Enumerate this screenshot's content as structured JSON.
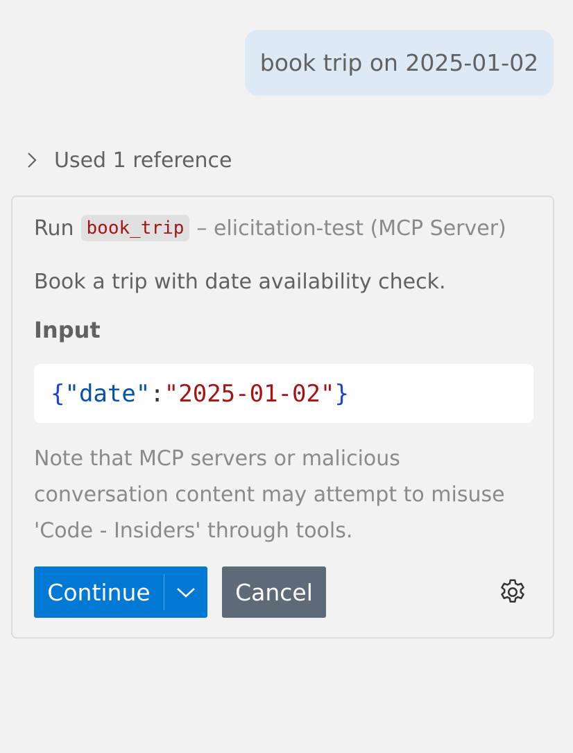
{
  "user_message": "book trip on 2025-01-02",
  "references": {
    "label": "Used 1 reference",
    "expand_icon": "chevron-right-icon"
  },
  "tool_card": {
    "run_prefix": "Run",
    "tool_name": "book_trip",
    "source_text": "– elicitation-test (MCP Server)",
    "description": "Book a trip with date availability check.",
    "input_label": "Input",
    "input_json": {
      "open_brace": "{",
      "key": "\"date\"",
      "colon": ":",
      "value": "\"2025-01-02\"",
      "close_brace": "}"
    },
    "note": "Note that MCP servers or malicious conversation content may attempt to misuse 'Code - Insiders' through tools.",
    "continue_label": "Continue",
    "continue_dropdown_icon": "chevron-down-icon",
    "cancel_label": "Cancel",
    "settings_icon": "gear-icon"
  },
  "colors": {
    "background": "#f2f2f2",
    "user_bubble": "#dde9f5",
    "primary_button": "#0078d4",
    "secondary_button": "#5f6a79",
    "code_string": "#a31515",
    "code_key": "#0451a5",
    "code_brace": "#1a3fe0"
  }
}
